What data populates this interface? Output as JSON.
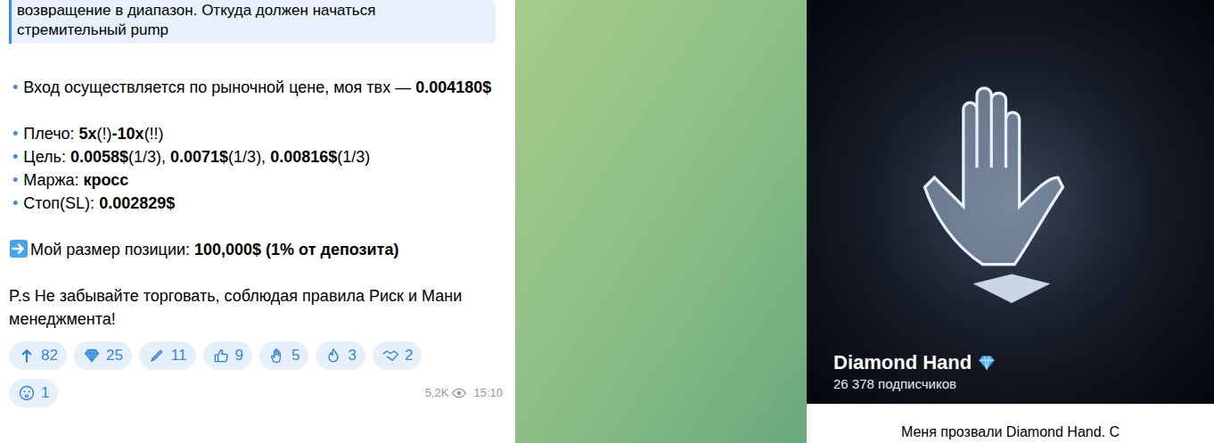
{
  "message": {
    "quote": [
      "возвращение в диапазон. Откуда должен начаться",
      "стремительный pump"
    ],
    "sections": [
      {
        "lines": [
          {
            "kind": "bullet",
            "bullet": "•",
            "parts": [
              {
                "text": "Вход осуществляется по рыночной цене, моя твх — ",
                "bold": false
              },
              {
                "text": "0.004180$",
                "bold": true
              }
            ]
          }
        ]
      },
      {
        "lines": [
          {
            "kind": "bullet",
            "bullet": "•",
            "parts": [
              {
                "text": "Плечо: ",
                "bold": false
              },
              {
                "text": "5х",
                "bold": true
              },
              {
                "text": "(!)",
                "bold": false
              },
              {
                "text": "-10х",
                "bold": true
              },
              {
                "text": "(!!)",
                "bold": false
              }
            ]
          },
          {
            "kind": "bullet",
            "bullet": "•",
            "parts": [
              {
                "text": "Цель: ",
                "bold": false
              },
              {
                "text": "0.0058$",
                "bold": true
              },
              {
                "text": "(1/3), ",
                "bold": false
              },
              {
                "text": "0.0071$",
                "bold": true
              },
              {
                "text": "(1/3), ",
                "bold": false
              },
              {
                "text": "0.00816$",
                "bold": true
              },
              {
                "text": "(1/3)",
                "bold": false
              }
            ]
          },
          {
            "kind": "bullet",
            "bullet": "•",
            "parts": [
              {
                "text": "Маржа: ",
                "bold": false
              },
              {
                "text": "кросс",
                "bold": true
              }
            ]
          },
          {
            "kind": "bullet",
            "bullet": "•",
            "parts": [
              {
                "text": "Стоп(SL): ",
                "bold": false
              },
              {
                "text": "0.002829$",
                "bold": true
              }
            ]
          }
        ]
      },
      {
        "lines": [
          {
            "kind": "arrow",
            "parts": [
              {
                "text": "Мой размер позиции: ",
                "bold": false
              },
              {
                "text": "100,000$ (1% от депозита)",
                "bold": true
              }
            ]
          }
        ]
      },
      {
        "lines": [
          {
            "kind": "plain",
            "parts": [
              {
                "text": "P.s Не забывайте торговать, соблюдая правила Риск и Мани менеджмента!",
                "bold": false
              }
            ]
          }
        ]
      }
    ],
    "reactions": [
      {
        "kind": "arrow",
        "count": "82"
      },
      {
        "kind": "diamond",
        "count": "25"
      },
      {
        "kind": "pen",
        "count": "11"
      },
      {
        "kind": "thumb",
        "count": "9"
      },
      {
        "kind": "clap",
        "count": "5"
      },
      {
        "kind": "fire",
        "count": "3"
      },
      {
        "kind": "handshake",
        "count": "2"
      },
      {
        "kind": "face",
        "count": "1"
      }
    ],
    "views": "5,2K",
    "time": "15:10"
  },
  "channel": {
    "title": "Diamond Hand",
    "subscribers": "26 378 подписчиков",
    "description": "Меня прозвали Diamond Hand. С"
  }
}
